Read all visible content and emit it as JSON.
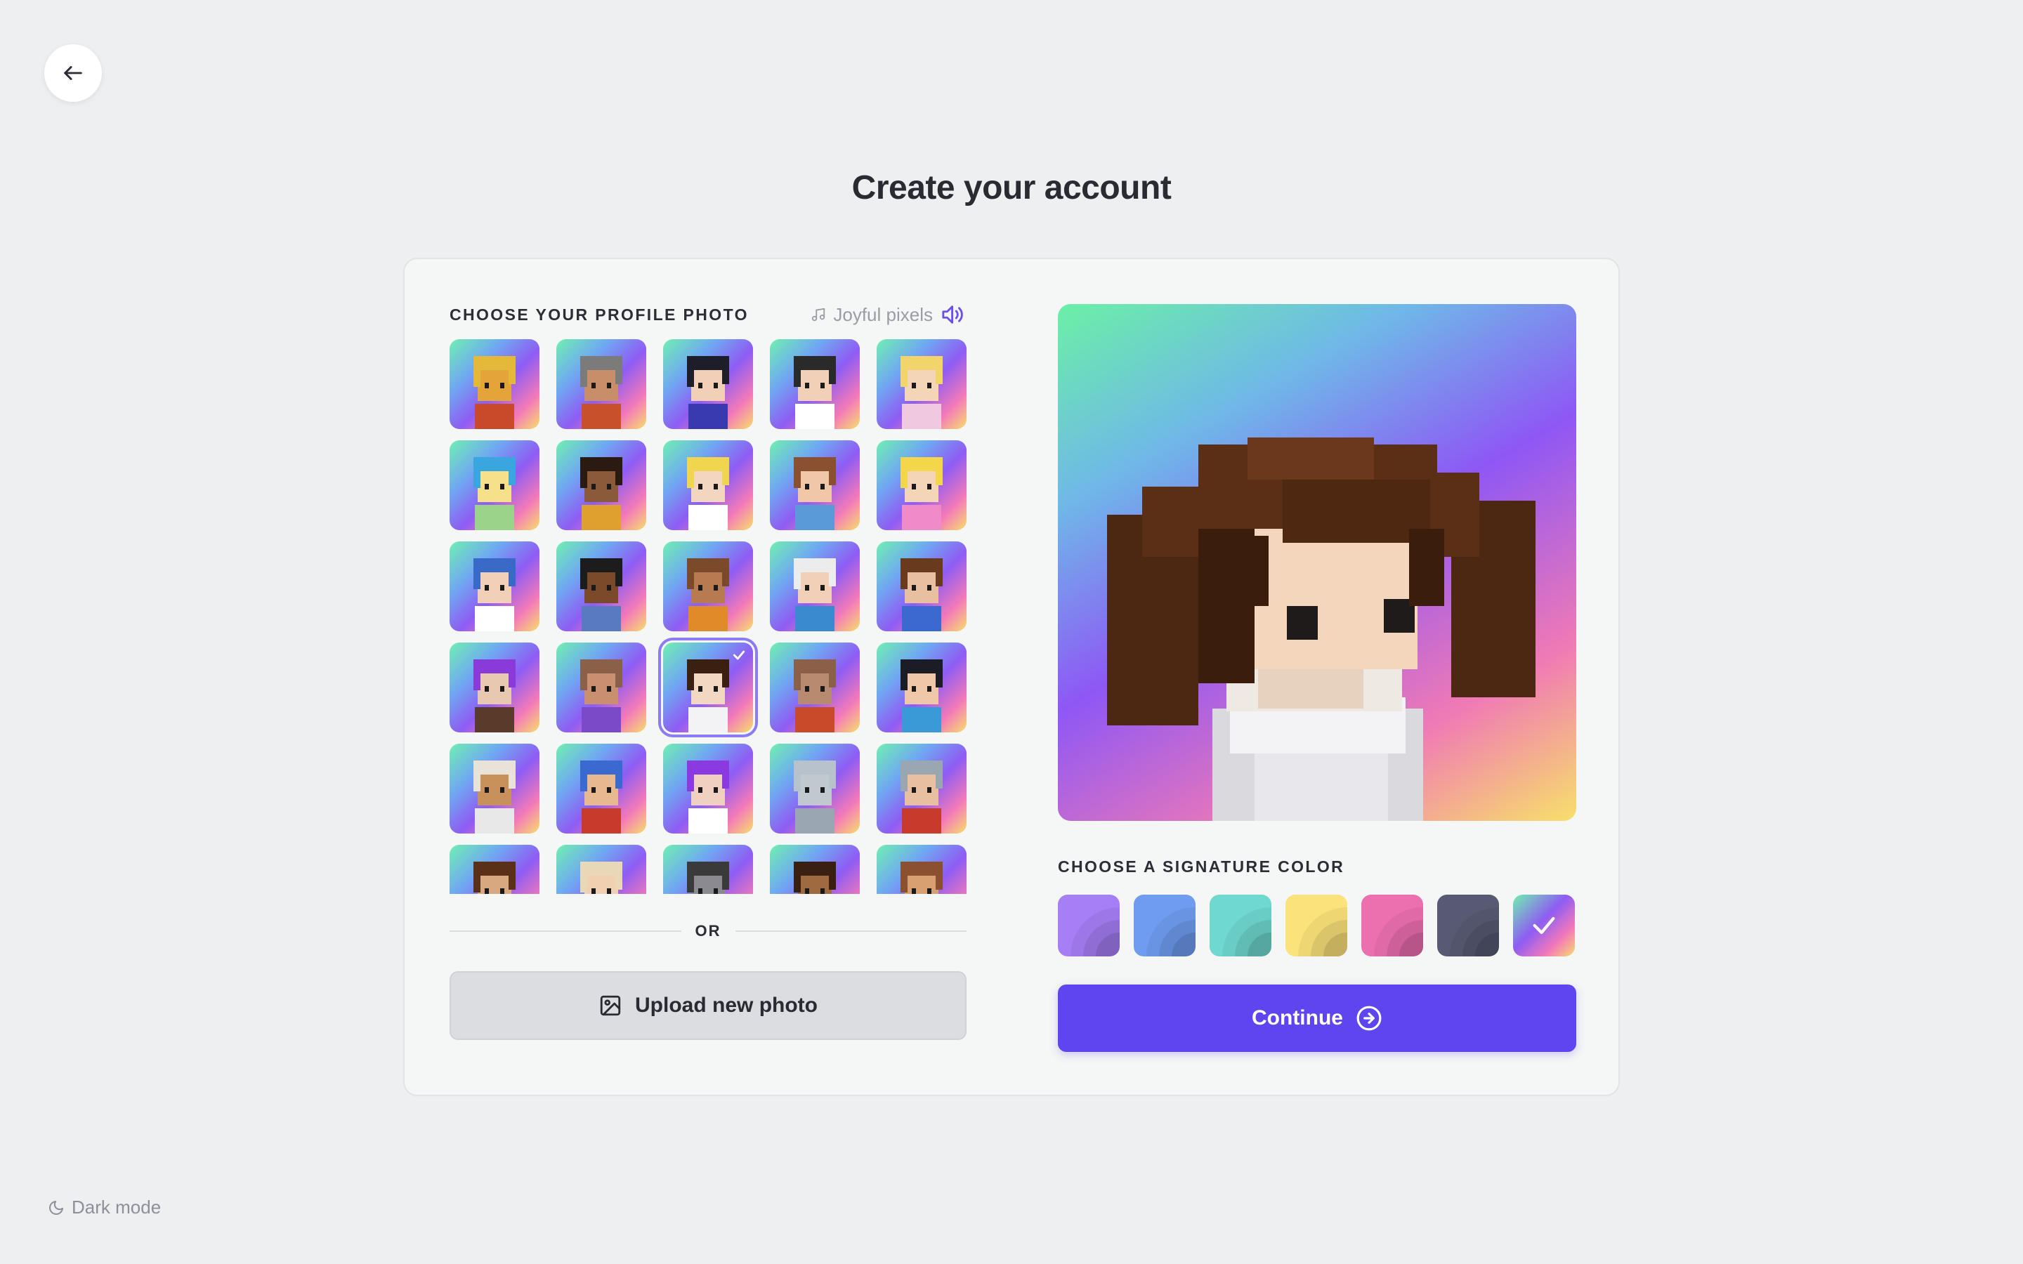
{
  "page": {
    "title": "Create your account"
  },
  "profile": {
    "label": "CHOOSE YOUR PROFILE PHOTO",
    "music_track": "Joyful pixels",
    "music_icon": "music-note-icon",
    "sound_icon": "speaker-volume-icon",
    "selected_index": 17,
    "avatar_count": 30
  },
  "divider": {
    "or_text": "OR"
  },
  "upload": {
    "label": "Upload new photo",
    "icon": "image-icon"
  },
  "signature": {
    "label": "CHOOSE A SIGNATURE COLOR",
    "colors": [
      {
        "name": "purple",
        "hex": "#a67ef5"
      },
      {
        "name": "blue",
        "hex": "#6f9cf0"
      },
      {
        "name": "teal",
        "hex": "#6fd9d0"
      },
      {
        "name": "yellow",
        "hex": "#fbe27a"
      },
      {
        "name": "pink",
        "hex": "#ec6fb0"
      },
      {
        "name": "slate",
        "hex": "#575a72"
      },
      {
        "name": "gradient",
        "hex": "gradient"
      }
    ],
    "selected_index": 6
  },
  "continue": {
    "label": "Continue",
    "icon": "arrow-right-circle-icon"
  },
  "footer": {
    "dark_mode_label": "Dark mode",
    "dark_mode_icon": "moon-icon"
  },
  "navigation": {
    "back_icon": "arrow-left-icon"
  },
  "colors": {
    "accent": "#5f45ef",
    "background": "#eeeff1",
    "card": "#f5f6f6"
  }
}
